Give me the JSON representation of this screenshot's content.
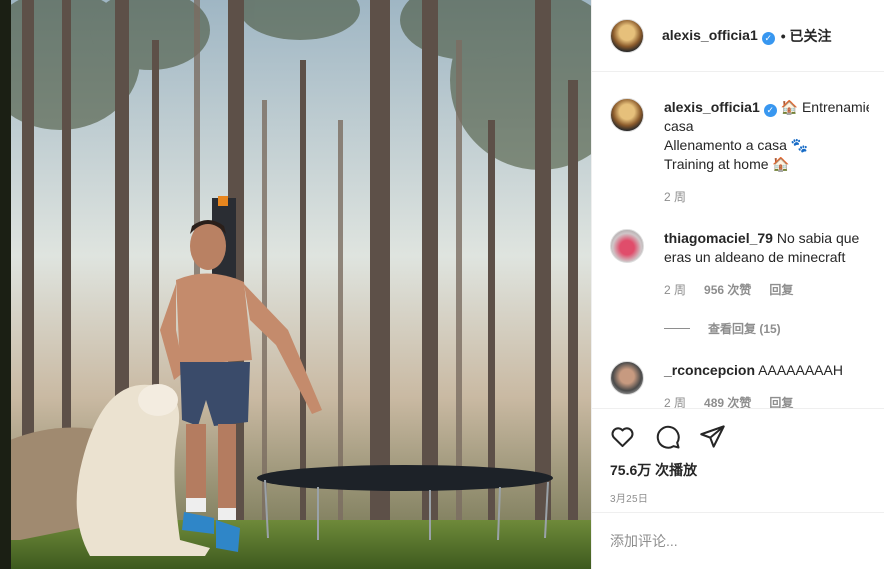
{
  "post": {
    "username": "alexis_officia1",
    "verified_glyph": "✓",
    "follow_status": "• 已关注",
    "caption_lines": [
      "🏠 Entrenamiento en",
      "casa",
      "Allenamento a casa 🐾",
      "Training at home 🏠"
    ],
    "caption_age": "2 周"
  },
  "comments": [
    {
      "username": "thiagomaciel_79",
      "text": "No sabia que",
      "text_line2": "eras un aldeano de minecraft",
      "age": "2 周",
      "likes": "956 次赞",
      "reply": "回复",
      "view_replies": "查看回复 (15)"
    },
    {
      "username": "_rconcepcion",
      "text": "AAAAAAAAH",
      "age": "2 周",
      "likes": "489 次赞",
      "reply": "回复"
    }
  ],
  "actions": {
    "like_icon": "heart-icon",
    "comment_icon": "comment-icon",
    "share_icon": "share-icon",
    "views": "75.6万 次播放",
    "date": "3月25日"
  },
  "add_comment": {
    "placeholder": "添加评论..."
  },
  "colors": {
    "verified": "#3897f0",
    "muted": "#8e8e8e",
    "border": "#efefef"
  }
}
